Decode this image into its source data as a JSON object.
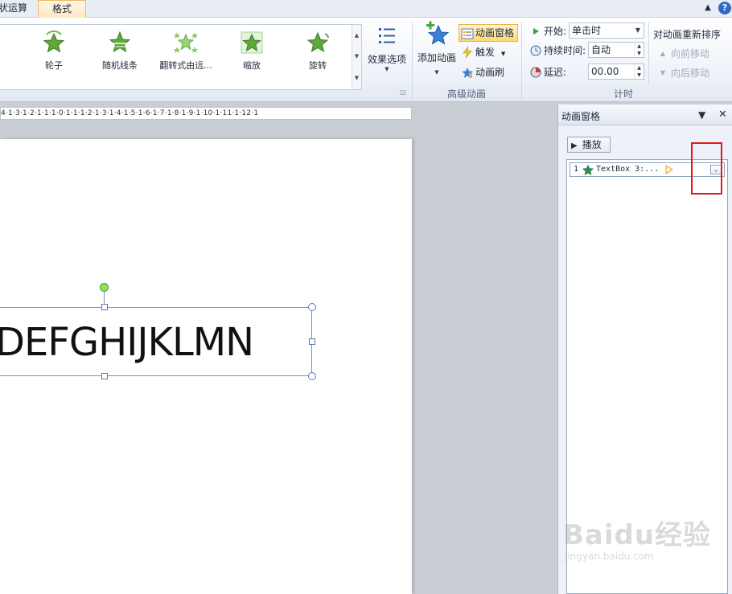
{
  "tabs": {
    "prev_tab_fragment": "状运算",
    "active_tab": "格式"
  },
  "ribbon": {
    "animation_gallery": [
      {
        "label": "轮子",
        "icon": "wheel-star-icon"
      },
      {
        "label": "随机线条",
        "icon": "random-bars-star-icon"
      },
      {
        "label": "翻转式由远...",
        "icon": "float-star-icon"
      },
      {
        "label": "缩放",
        "icon": "zoom-star-icon"
      },
      {
        "label": "旋转",
        "icon": "spin-star-icon"
      }
    ],
    "effect_options_label": "效果选项",
    "advanced_animation": {
      "group_label": "高级动画",
      "add_animation_label": "添加动画",
      "animation_pane_label": "动画窗格",
      "trigger_label": "触发",
      "animation_painter_label": "动画刷"
    },
    "timing": {
      "group_label": "计时",
      "start_label": "开始:",
      "start_value": "单击时",
      "duration_label": "持续时间:",
      "duration_value": "自动",
      "delay_label": "延迟:",
      "delay_value": "00.00"
    },
    "reorder": {
      "title": "对动画重新排序",
      "move_earlier_label": "向前移动",
      "move_later_label": "向后移动"
    }
  },
  "ruler": {
    "text": "4·1·3·1·2·1·1·1·0·1·1·1·2·1·3·1·4·1·5·1·6·1·7·1·8·1·9·1·10·1·11·1·12·1"
  },
  "slide": {
    "textbox_text": "DEFGHIJKLMN"
  },
  "animation_pane": {
    "title": "动画窗格",
    "play_label": "播放",
    "items": [
      {
        "number": "1",
        "name": "TextBox 3:..."
      }
    ]
  },
  "watermark": {
    "logo": "Baidu经验",
    "url": "jingyan.baidu.com"
  },
  "colors": {
    "accent_orange": "#f0b865",
    "star_green": "#5fa83a",
    "highlight_red": "#e01818",
    "selection_blue": "#7493c4"
  }
}
